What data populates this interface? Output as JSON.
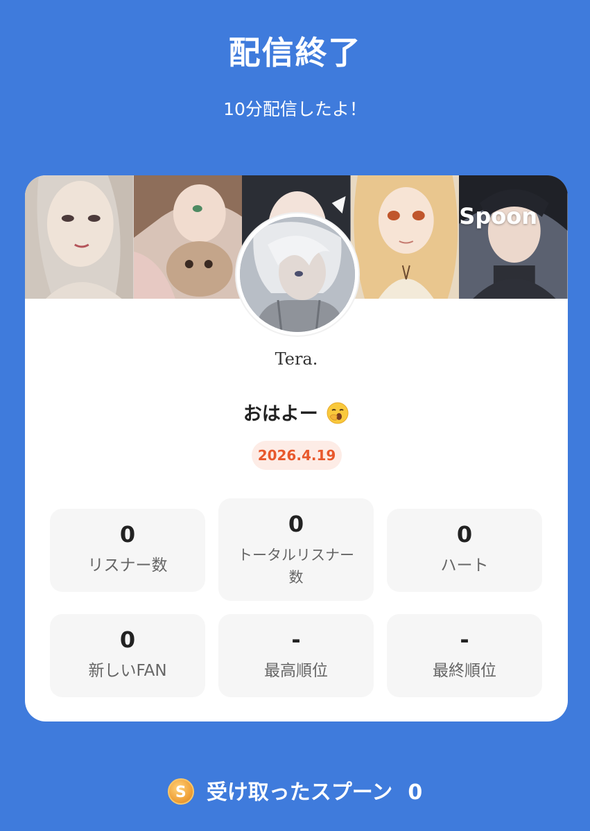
{
  "header": {
    "title": "配信終了",
    "subtitle": "10分配信したよ！"
  },
  "banner": {
    "brand": "Spoon"
  },
  "profile": {
    "username": "Tera.",
    "live_title": "おはよー",
    "live_title_emoji": "yawning-face-icon",
    "date": "2026.4.19"
  },
  "stats": [
    {
      "value": "0",
      "label": "リスナー数"
    },
    {
      "value": "0",
      "label": "トータルリスナー数"
    },
    {
      "value": "0",
      "label": "ハート"
    },
    {
      "value": "0",
      "label": "新しいFAN"
    },
    {
      "value": "-",
      "label": "最高順位"
    },
    {
      "value": "-",
      "label": "最終順位"
    }
  ],
  "footer": {
    "coin_letter": "S",
    "label": "受け取ったスプーン",
    "value": "0"
  },
  "colors": {
    "background": "#3f7bdc",
    "card": "#ffffff",
    "stat_box": "#f6f6f6",
    "date_text": "#e8582c",
    "date_bg": "#fdece6"
  }
}
